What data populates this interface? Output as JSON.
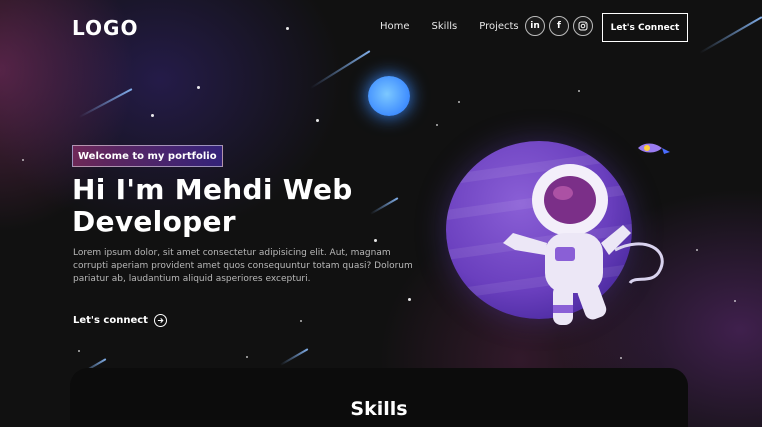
{
  "nav": {
    "logo": "LOGO",
    "links": [
      "Home",
      "Skills",
      "Projects"
    ],
    "socials": [
      {
        "icon": "linkedin-icon",
        "glyph": "in"
      },
      {
        "icon": "facebook-icon",
        "glyph": "f"
      },
      {
        "icon": "instagram-icon",
        "glyph": "◎"
      }
    ],
    "connect_label": "Let's Connect"
  },
  "hero": {
    "tagline": "Welcome to my portfolio",
    "headline": "Hi I'm Mehdi Web Developer",
    "description": "Lorem ipsum dolor, sit amet consectetur adipisicing elit. Aut, magnam corrupti aperiam provident amet quos consequuntur totam quasi? Dolorum pariatur ab, laudantium aliquid asperiores excepturi.",
    "cta_label": "Let's connect",
    "cta_icon": "arrow-right-circle-icon"
  },
  "skills": {
    "title": "Skills"
  },
  "colors": {
    "background": "#121212",
    "accent_pink": "#AA367C",
    "accent_purple": "#4A2FBD",
    "planet": "#6A3FBE",
    "moon": "#3F8DFF"
  }
}
